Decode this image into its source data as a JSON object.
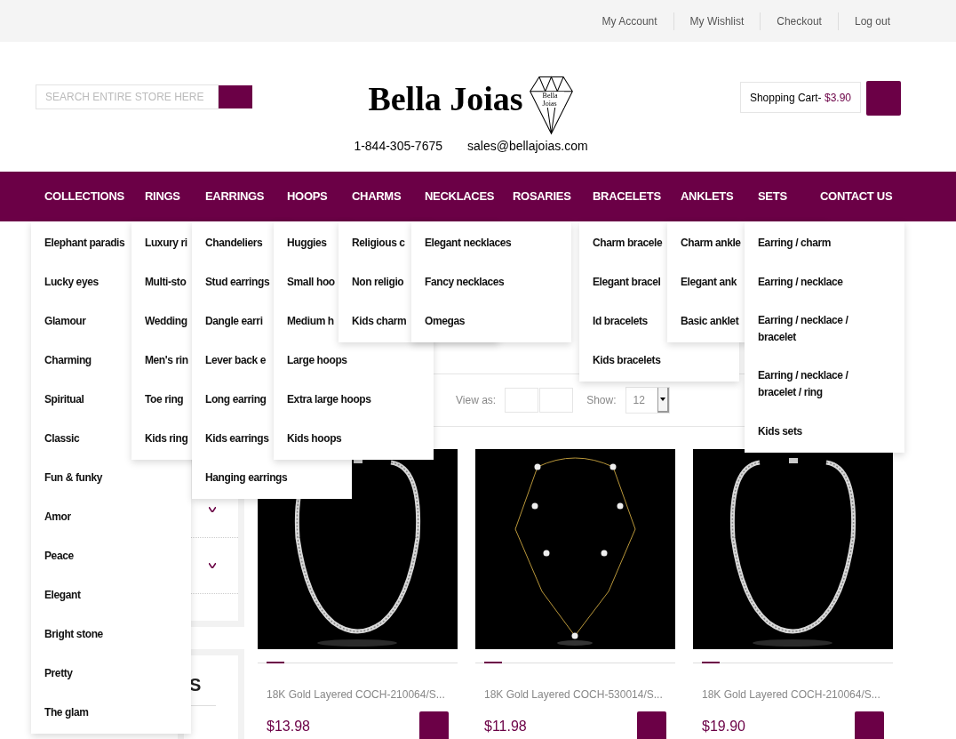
{
  "top_links": [
    "My Account",
    "My Wishlist",
    "Checkout",
    "Log out"
  ],
  "search": {
    "placeholder": "SEARCH ENTIRE STORE HERE"
  },
  "logo": {
    "wordmark": "Bella Joias",
    "mark_text": "Bella Joias"
  },
  "contact": {
    "phone": "1-844-305-7675",
    "email": "sales@bellajoias.com"
  },
  "cart": {
    "label": "Shopping Cart-",
    "amount": "$3.90"
  },
  "nav": [
    {
      "label": "COLLECTIONS",
      "menu": [
        "Elephant paradis",
        "Lucky eyes",
        "Glamour",
        "Charming",
        "Spiritual",
        "Classic",
        "Fun & funky",
        "Amor",
        "Peace",
        "Elegant",
        "Bright stone",
        "Pretty",
        "The glam"
      ]
    },
    {
      "label": "RINGS",
      "menu": [
        "Luxury ri",
        "Multi-sto",
        "Wedding",
        "Men's rin",
        "Toe ring",
        "Kids ring"
      ]
    },
    {
      "label": "EARRINGS",
      "menu": [
        "Chandeliers",
        "Stud earrings",
        "Dangle earri",
        "Lever back e",
        "Long earring",
        "Kids earrings",
        "Hanging earrings"
      ]
    },
    {
      "label": "HOOPS",
      "menu": [
        "Huggies",
        "Small hoo",
        "Medium h",
        "Large hoops",
        "Extra large hoops",
        "Kids hoops"
      ]
    },
    {
      "label": "CHARMS",
      "menu": [
        "Religious c",
        "Non religio",
        "Kids charm"
      ]
    },
    {
      "label": "NECKLACES",
      "menu": [
        "Elegant necklaces",
        "Fancy necklaces",
        "Omegas"
      ]
    },
    {
      "label": "ROSARIES"
    },
    {
      "label": "BRACELETS",
      "menu": [
        "Charm bracele",
        "Elegant bracel",
        "Id bracelets",
        "Kids bracelets"
      ]
    },
    {
      "label": "ANKLETS",
      "menu": [
        "Charm ankle",
        "Elegant ank",
        "Basic anklet"
      ]
    },
    {
      "label": "SETS",
      "menu": [
        "Earring / charm",
        "Earring / necklace",
        "Earring / necklace / bracelet",
        "Earring / necklace / bracelet / ring",
        "Kids sets"
      ]
    },
    {
      "label": "CONTACT US"
    }
  ],
  "toolbar": {
    "view_label": "View as:",
    "show_label": "Show:",
    "show_value": "12"
  },
  "sidebar": {
    "section_2_title": "S"
  },
  "products": [
    {
      "title": "18K Gold Layered COCH-210064/S...",
      "price": "$13.98"
    },
    {
      "title": "18K Gold Layered COCH-530014/S...",
      "price": "$11.98"
    },
    {
      "title": "18K Gold Layered COCH-210064/S...",
      "price": "$19.90"
    }
  ]
}
